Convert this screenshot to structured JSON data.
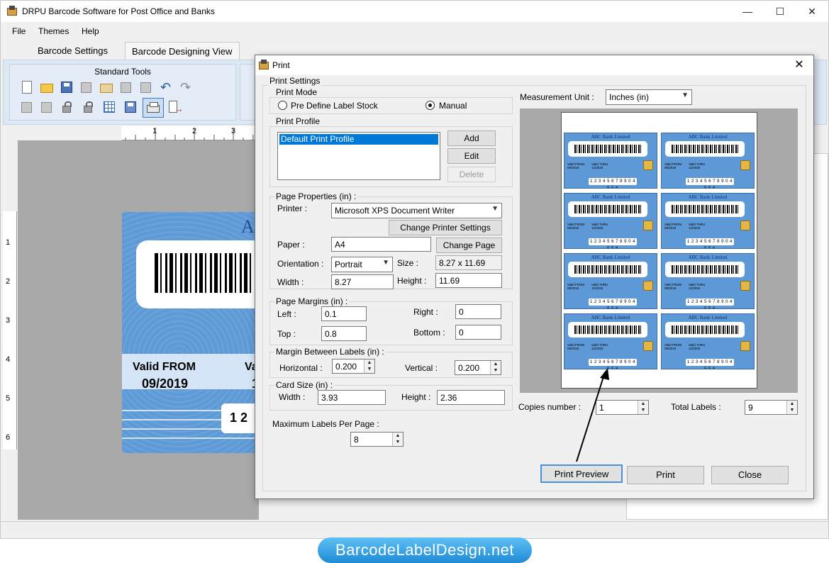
{
  "window": {
    "title": "DRPU Barcode Software for Post Office and Banks",
    "minimize": "—",
    "maximize": "☐",
    "close": "✕"
  },
  "menu": [
    "File",
    "Themes",
    "Help"
  ],
  "tabs": [
    "Barcode Settings",
    "Barcode Designing View"
  ],
  "ribbon": {
    "group_title": "Standard Tools"
  },
  "ruler": {
    "top": [
      "1",
      "2",
      "3"
    ],
    "left": [
      "1",
      "2",
      "3",
      "4",
      "5",
      "6"
    ]
  },
  "canvas_card": {
    "header": "A",
    "valid_from_label": "Valid FROM",
    "valid_from_date": "09/2019",
    "valid_thru_label": "Va",
    "valid_thru_date": "1",
    "number": "1 2"
  },
  "dialog": {
    "title": "Print",
    "close": "✕",
    "print_settings": "Print Settings",
    "print_mode": {
      "label": "Print Mode",
      "options": [
        "Pre Define Label Stock",
        "Manual"
      ],
      "selected": "Manual"
    },
    "print_profile": {
      "label": "Print Profile",
      "items": [
        "Default Print Profile"
      ],
      "add": "Add",
      "edit": "Edit",
      "delete": "Delete"
    },
    "page_properties": {
      "label": "Page Properties (in) :",
      "printer_label": "Printer :",
      "printer": "Microsoft XPS Document Writer",
      "change_printer": "Change Printer Settings",
      "paper_label": "Paper :",
      "paper": "A4",
      "change_page": "Change Page",
      "orientation_label": "Orientation :",
      "orientation": "Portrait",
      "size_label": "Size :",
      "size": "8.27 x 11.69",
      "width_label": "Width :",
      "width": "8.27",
      "height_label": "Height :",
      "height": "11.69"
    },
    "page_margins": {
      "label": "Page Margins (in) :",
      "left_label": "Left :",
      "left": "0.1",
      "right_label": "Right :",
      "right": "0",
      "top_label": "Top :",
      "top": "0.8",
      "bottom_label": "Bottom :",
      "bottom": "0"
    },
    "margin_between": {
      "label": "Margin Between Labels (in) :",
      "horizontal_label": "Horizontal :",
      "horizontal": "0.200",
      "vertical_label": "Vertical :",
      "vertical": "0.200"
    },
    "card_size": {
      "label": "Card Size (in) :",
      "width_label": "Width :",
      "width": "3.93",
      "height_label": "Height :",
      "height": "2.36"
    },
    "max_labels": {
      "label": "Maximum Labels Per Page :",
      "value": "8"
    },
    "measurement": {
      "label": "Measurement Unit :",
      "value": "Inches (in)"
    },
    "preview_label": {
      "bank": "ABC Bank Limited",
      "valid_from": "Valid FROM",
      "valid_from_date": "09/2019",
      "valid_thru": "Valid THRU",
      "valid_thru_date": "12/2025",
      "number": "1 2 3 4 5 6 7 8 9 0 4 5 5 6"
    },
    "copies": {
      "label": "Copies number :",
      "value": "1"
    },
    "total_labels": {
      "label": "Total Labels :",
      "value": "9"
    },
    "buttons": {
      "preview": "Print Preview",
      "print": "Print",
      "close": "Close"
    }
  },
  "banner": "BarcodeLabelDesign.net"
}
